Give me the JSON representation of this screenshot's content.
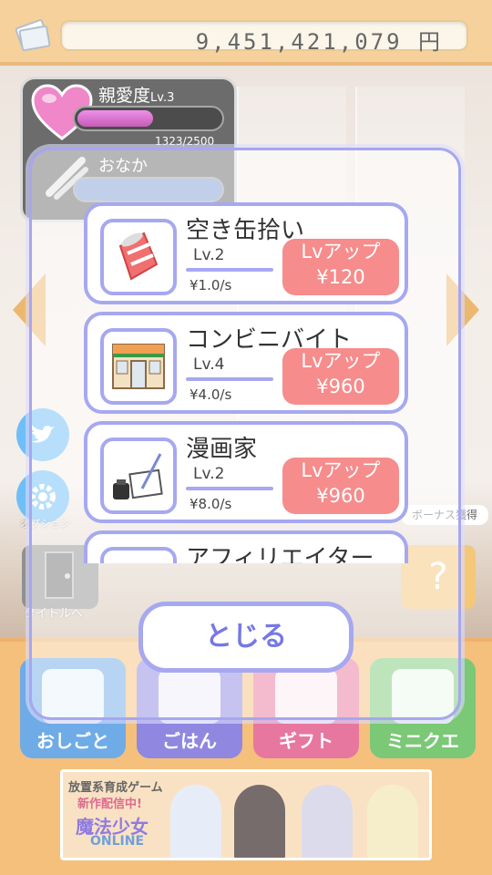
{
  "topbar": {
    "money": "9,451,421,079 円"
  },
  "status": {
    "affection_label": "親愛度",
    "affection_level": "Lv.3",
    "affection_value": "1323/2500",
    "affection_progress": 0.53,
    "hunger_label": "おなか"
  },
  "side": {
    "option_label": "オプション",
    "title_label": "タイトルへ",
    "bonus_label": "ボーナス獲得",
    "mystery_label": "?"
  },
  "modal": {
    "jobs": [
      {
        "title": "空き缶拾い",
        "level": "Lv.2",
        "rate": "¥1.0/s",
        "button_line1": "Lvアップ",
        "button_line2": "¥120"
      },
      {
        "title": "コンビニバイト",
        "level": "Lv.4",
        "rate": "¥4.0/s",
        "button_line1": "Lvアップ",
        "button_line2": "¥960"
      },
      {
        "title": "漫画家",
        "level": "Lv.2",
        "rate": "¥8.0/s",
        "button_line1": "Lvアップ",
        "button_line2": "¥960"
      },
      {
        "title": "アフィリエイター",
        "level": "",
        "rate": "",
        "button_line1": "",
        "button_line2": ""
      }
    ],
    "close_label": "とじる"
  },
  "tabs": [
    {
      "label": "おしごと",
      "color": "#3e8fdf"
    },
    {
      "label": "ごはん",
      "color": "#6a5fd6"
    },
    {
      "label": "ギフト",
      "color": "#e04a7f"
    },
    {
      "label": "ミニクエ",
      "color": "#4fb64a"
    }
  ],
  "banner": {
    "line1": "放置系育成ゲーム",
    "line2": "新作配信中!",
    "line3": "魔法少女",
    "line4": "ONLINE"
  },
  "colors": {
    "accent": "#a6a8f0",
    "lvup": "#f68c8c",
    "topbar": "#f4c27a"
  }
}
